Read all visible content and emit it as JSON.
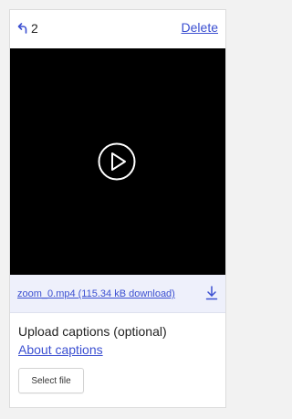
{
  "header": {
    "back_count": "2",
    "delete_label": "Delete"
  },
  "video": {
    "play_icon": "play-circle-icon"
  },
  "file": {
    "link_text": "zoom_0.mp4 (115.34 kB download)",
    "download_icon": "download-icon"
  },
  "captions": {
    "title": "Upload captions (optional)",
    "about_link": "About captions",
    "select_button": "Select file"
  },
  "colors": {
    "link": "#3b4fd1",
    "video_bg": "#000000",
    "file_row_bg": "#eef0fb"
  }
}
